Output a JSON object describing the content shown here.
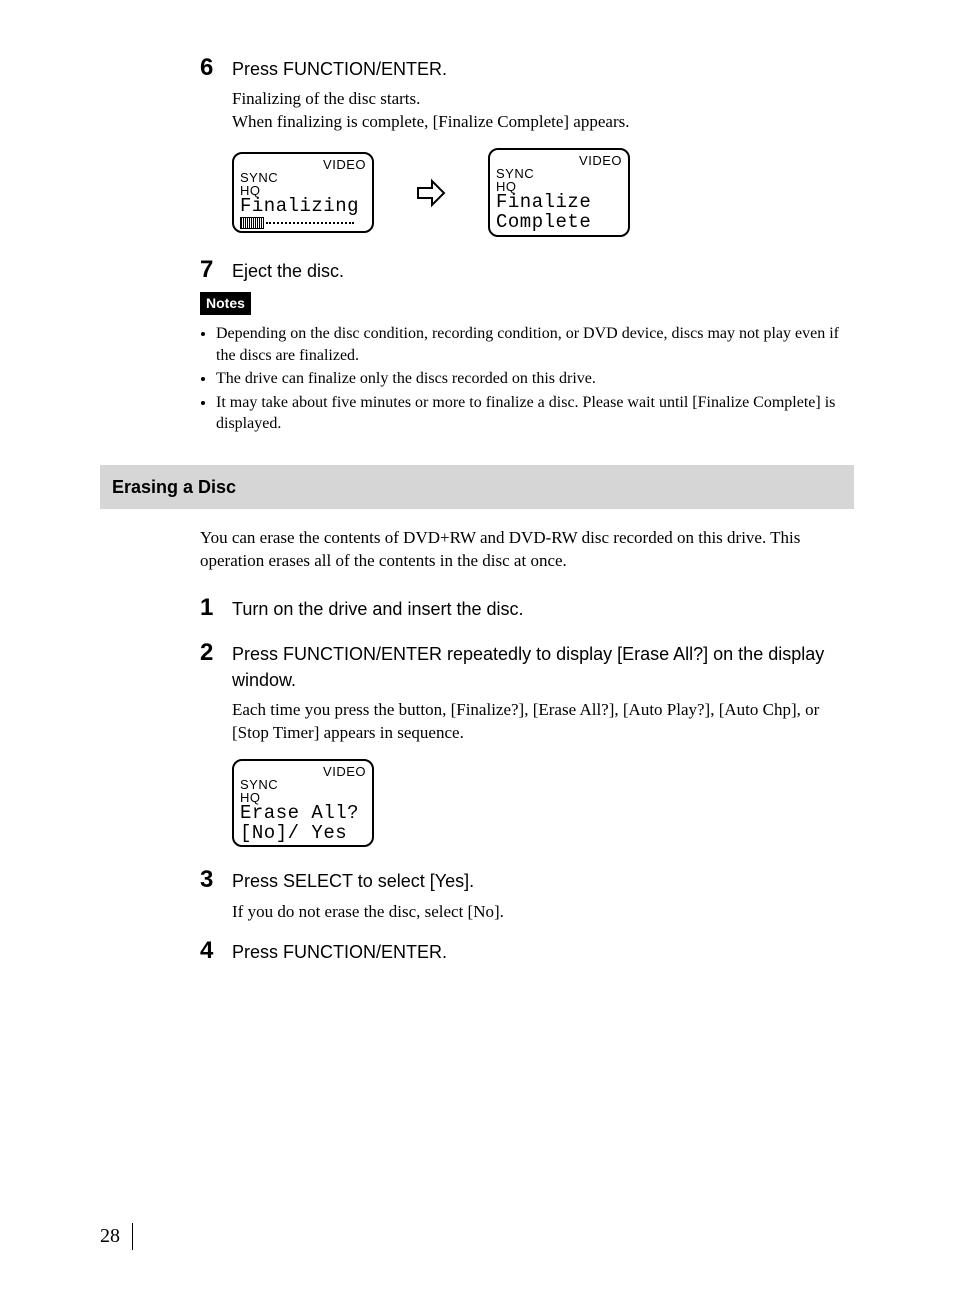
{
  "steps_top": [
    {
      "n": "6",
      "title": "Press FUNCTION/ENTER.",
      "body": [
        "Finalizing of the disc starts.",
        "When finalizing is complete, [Finalize Complete] appears."
      ]
    },
    {
      "n": "7",
      "title": "Eject the disc.",
      "body": []
    }
  ],
  "lcd_before": {
    "video": "VIDEO",
    "sync": "SYNC",
    "hq": "HQ",
    "line1": "Finalizing",
    "line2_is_progress": true
  },
  "lcd_after": {
    "video": "VIDEO",
    "sync": "SYNC",
    "hq": "HQ",
    "line1": "Finalize",
    "line2": " Complete"
  },
  "notes_label": "Notes",
  "notes": [
    "Depending on the disc condition, recording condition, or DVD device, discs may not play even if the discs are finalized.",
    "The drive can finalize only the discs recorded on this drive.",
    "It may take about five minutes or more to finalize a disc. Please wait until [Finalize Complete] is displayed."
  ],
  "section_title": "Erasing a Disc",
  "section_intro": "You can erase the contents of DVD+RW and DVD-RW disc recorded on this drive. This operation erases all of the contents in the disc at once.",
  "steps_bottom": [
    {
      "n": "1",
      "title": "Turn on the drive and insert the disc.",
      "body": []
    },
    {
      "n": "2",
      "title": "Press FUNCTION/ENTER repeatedly to display [Erase All?] on the display window.",
      "body": [
        "Each time you press the button, [Finalize?], [Erase All?], [Auto Play?], [Auto Chp], or [Stop Timer] appears in sequence."
      ]
    },
    {
      "n": "3",
      "title": "Press SELECT to select [Yes].",
      "body": [
        "If you do not erase the disc, select [No]."
      ]
    },
    {
      "n": "4",
      "title": "Press FUNCTION/ENTER.",
      "body": []
    }
  ],
  "lcd_erase": {
    "video": "VIDEO",
    "sync": "SYNC",
    "hq": "HQ",
    "line1": "Erase All?",
    "line2": "[No]/ Yes"
  },
  "page_number": "28"
}
